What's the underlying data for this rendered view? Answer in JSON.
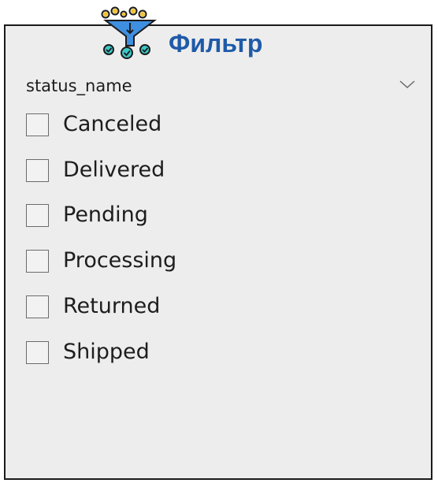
{
  "slicer": {
    "title": "Фильтр",
    "field_name": "status_name",
    "options": [
      {
        "label": "Canceled",
        "checked": false
      },
      {
        "label": "Delivered",
        "checked": false
      },
      {
        "label": "Pending",
        "checked": false
      },
      {
        "label": "Processing",
        "checked": false
      },
      {
        "label": "Returned",
        "checked": false
      },
      {
        "label": "Shipped",
        "checked": false
      }
    ]
  },
  "colors": {
    "title": "#1f5aa8",
    "panel_background": "#ededed",
    "panel_border": "#1b1b1b",
    "logo_circles": "#f2c230",
    "logo_funnel": "#3f8fe0",
    "logo_check": "#3cc7c7"
  },
  "icons": {
    "logo": "filter-funnel-icon",
    "dropdown": "chevron-down-icon",
    "option_box": "checkbox-icon"
  }
}
